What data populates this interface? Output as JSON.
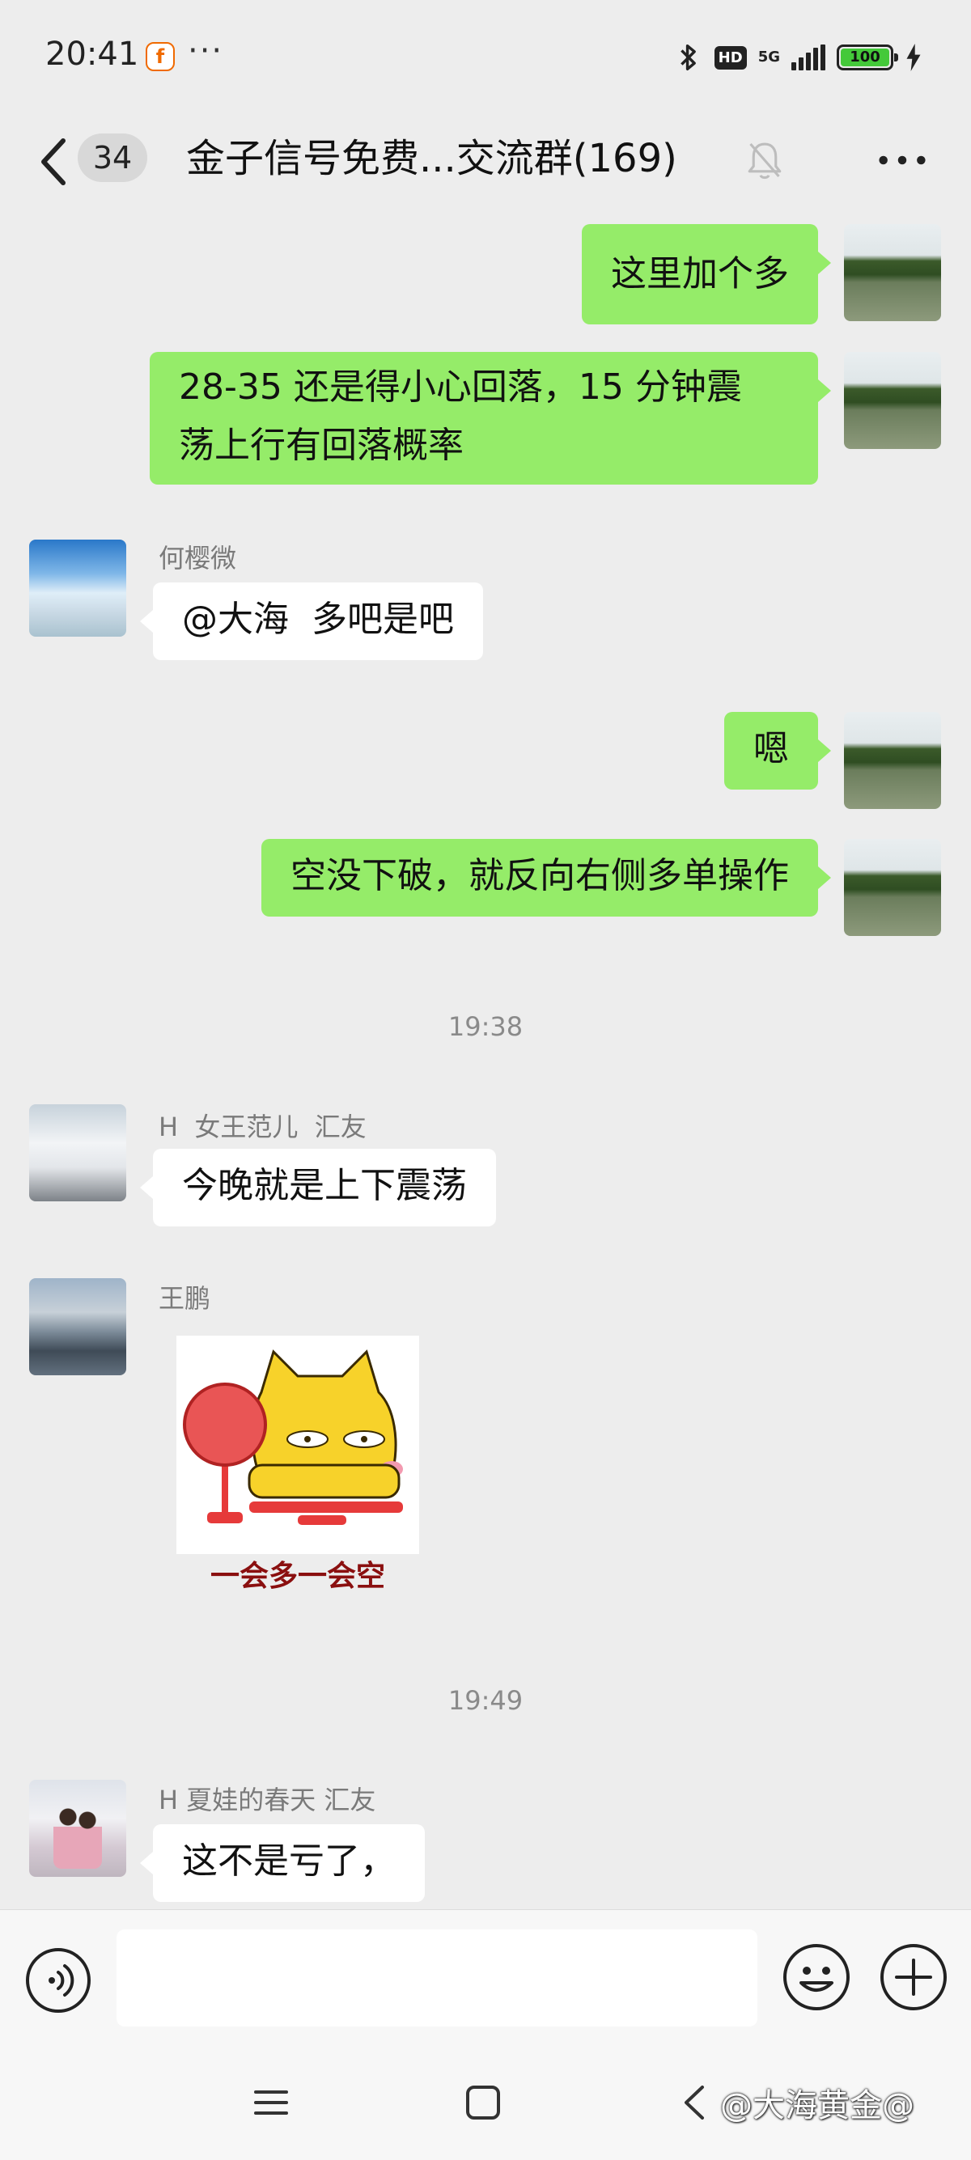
{
  "status_bar": {
    "time": "20:41",
    "app_notification_icon": "app-notification-icon",
    "overflow_dots": "···",
    "network_hd": "HD",
    "network_type": "5G",
    "battery_level": "100"
  },
  "header": {
    "unread_count": "34",
    "title": "金子信号免费...交流群(169)"
  },
  "messages": [
    {
      "direction": "out",
      "text": "这里加个多"
    },
    {
      "direction": "out",
      "text_lines": [
        "28-35 还是得小心回落，15 分钟震",
        "荡上行有回落概率"
      ]
    },
    {
      "direction": "in",
      "sender": "何樱微",
      "text": "@大海  多吧是吧"
    },
    {
      "direction": "out",
      "text": "嗯"
    },
    {
      "direction": "out",
      "text": "空没下破，就反向右侧多单操作"
    },
    {
      "type": "timestamp",
      "text": "19:38"
    },
    {
      "direction": "in",
      "sender": "H  女王范儿  汇友",
      "text": "今晚就是上下震荡"
    },
    {
      "direction": "in",
      "sender": "王鹏",
      "type": "sticker",
      "sticker_caption": "一会多一会空"
    },
    {
      "type": "timestamp",
      "text": "19:49"
    },
    {
      "direction": "in",
      "sender": "H 夏娃的春天 汇友",
      "text": "这不是亏了，"
    }
  ],
  "input_bar": {
    "placeholder": ""
  },
  "watermark": "@大海黄金@",
  "colors": {
    "outgoing_bubble": "#95ec69",
    "incoming_bubble": "#ffffff",
    "background": "#ededed",
    "battery_fill": "#44c93a",
    "sticker_caption": "#8a0f0f"
  }
}
